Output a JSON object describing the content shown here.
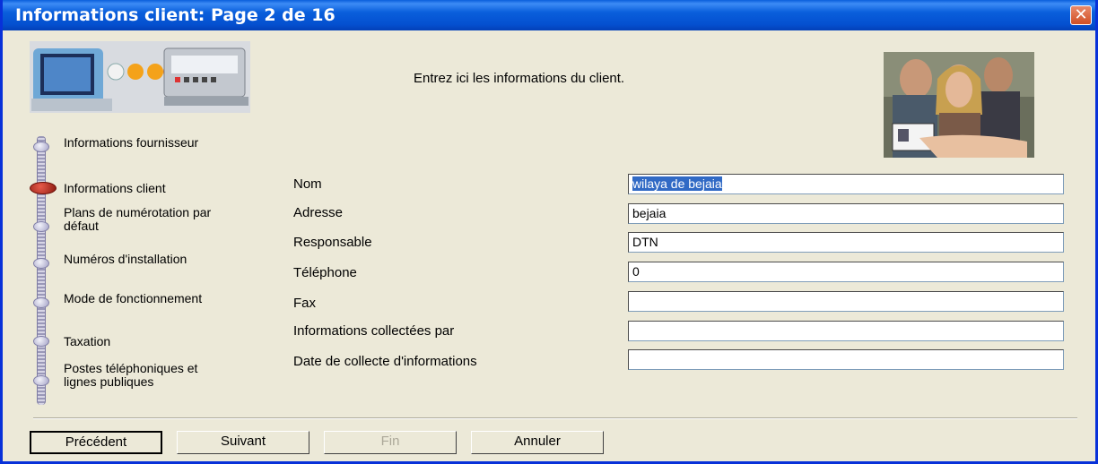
{
  "window": {
    "title": "Informations client:  Page 2 de 16",
    "close_glyph": "✕"
  },
  "header": {
    "instruction": "Entrez ici les informations du client."
  },
  "wizard_steps": [
    {
      "label": "Informations fournisseur",
      "active": false
    },
    {
      "label": "Informations client",
      "active": true
    },
    {
      "label": "Plans de numérotation par défaut",
      "active": false
    },
    {
      "label": "Numéros d'installation",
      "active": false
    },
    {
      "label": "Mode de fonctionnement",
      "active": false
    },
    {
      "label": "Taxation",
      "active": false
    },
    {
      "label": "Postes téléphoniques et lignes publiques",
      "active": false
    }
  ],
  "form": {
    "nom": {
      "label": "Nom",
      "value": "wilaya de bejaia"
    },
    "adresse": {
      "label": "Adresse",
      "value": "bejaia"
    },
    "responsable": {
      "label": "Responsable",
      "value": "DTN"
    },
    "telephone": {
      "label": "Téléphone",
      "value": "0"
    },
    "fax": {
      "label": "Fax",
      "value": ""
    },
    "collectees": {
      "label": "Informations collectées par",
      "value": ""
    },
    "date": {
      "label": "Date de collecte d'informations",
      "value": ""
    }
  },
  "buttons": {
    "previous": "Précédent",
    "next": "Suivant",
    "finish": "Fin",
    "cancel": "Annuler"
  },
  "colors": {
    "titlebar": "#0a5fdc",
    "dialog_bg": "#ece9d8",
    "selection": "#316ac5",
    "active_step": "#b02418"
  }
}
